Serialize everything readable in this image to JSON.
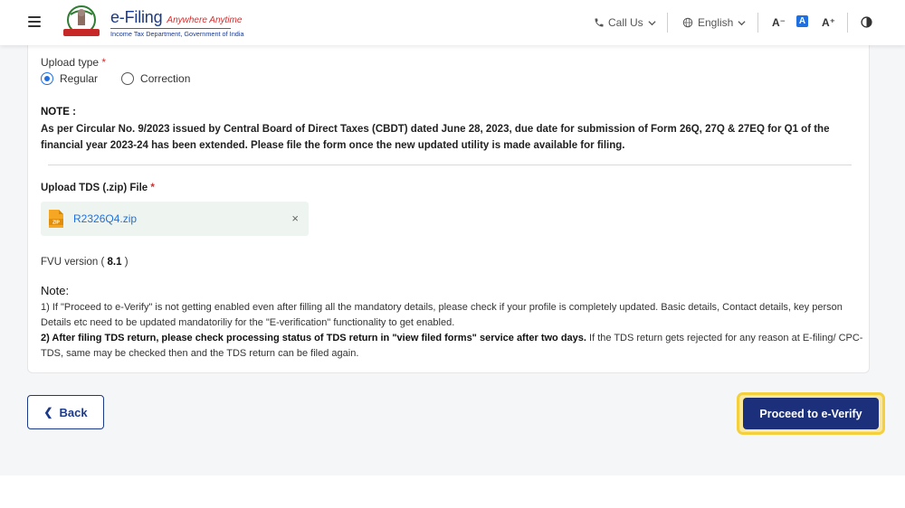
{
  "header": {
    "brand_main": "e-Filing",
    "brand_tag": "Anywhere Anytime",
    "brand_sub": "Income Tax Department, Government of India",
    "call_us": "Call Us",
    "language": "English",
    "font_decrease": "A⁻",
    "font_normal": "A",
    "font_increase": "A⁺"
  },
  "form": {
    "upload_type_label": "Upload type",
    "required_mark": "*",
    "radio_regular": "Regular",
    "radio_correction": "Correction",
    "selected_upload_type": "Regular",
    "note_title": "NOTE :",
    "note_body": "As per Circular No. 9/2023 issued by Central Board of Direct Taxes (CBDT) dated June 28, 2023, due date for submission of Form 26Q, 27Q & 27EQ for Q1 of the financial year 2023-24 has been extended. Please file the form once the new updated utility is made available for filing.",
    "upload_label": "Upload TDS (.zip) File",
    "file_name": "R2326Q4.zip",
    "file_type_badge": "ZIP",
    "remove_symbol": "×",
    "fvu_prefix": "FVU version (",
    "fvu_version": "8.1",
    "fvu_suffix": ")"
  },
  "note2": {
    "title": "Note:",
    "item1": "1) If \"Proceed to e-Verify\" is not getting enabled even after filling all the mandatory details, please check if your profile is completely updated. Basic details, Contact details, key person Details etc need to be updated mandatoriliy for the \"E-verification\" functionality to get enabled.",
    "item2_bold": "2) After filing TDS return, please check processing status of TDS return in \"view filed forms\" service after two days.",
    "item2_rest": " If the TDS return gets rejected for any reason at E-filing/ CPC-TDS, same may be checked then and the TDS return can be filed again."
  },
  "actions": {
    "back_label": "Back",
    "proceed_label": "Proceed to e-Verify"
  },
  "colors": {
    "brand_blue": "#1b3a8c",
    "accent_blue": "#1f6fe0",
    "primary_button": "#1b2f7a",
    "highlight": "#f4d03f",
    "required_red": "#d32f2f"
  }
}
